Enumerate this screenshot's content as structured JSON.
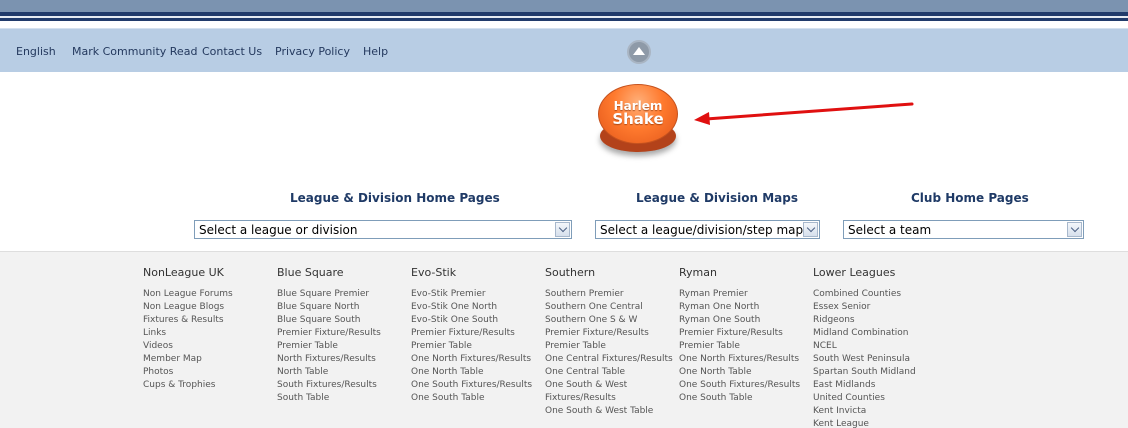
{
  "nav": {
    "links": [
      "English",
      "Mark Community Read",
      "Contact Us",
      "Privacy Policy",
      "Help"
    ]
  },
  "promo": {
    "line1": "Harlem",
    "line2": "Shake"
  },
  "selectors": [
    {
      "title": "League & Division Home Pages",
      "value": "Select a league or division"
    },
    {
      "title": "League & Division Maps",
      "value": "Select a league/division/step map"
    },
    {
      "title": "Club Home Pages",
      "value": "Select a team"
    }
  ],
  "footer": {
    "columns": [
      {
        "heading": "NonLeague UK",
        "items": [
          "Non League Forums",
          "Non League Blogs",
          "Fixtures & Results",
          "Links",
          "Videos",
          "Member Map",
          "Photos",
          "Cups & Trophies"
        ]
      },
      {
        "heading": "Blue Square",
        "items": [
          "Blue Square Premier",
          "Blue Square North",
          "Blue Square South",
          "Premier Fixture/Results",
          "Premier Table",
          "North Fixtures/Results",
          "North Table",
          "South Fixtures/Results",
          "South Table"
        ]
      },
      {
        "heading": "Evo-Stik",
        "items": [
          "Evo-Stik Premier",
          "Evo-Stik One North",
          "Evo-Stik One South",
          "Premier Fixture/Results",
          "Premier Table",
          "One North Fixtures/Results",
          "One North Table",
          "One South Fixtures/Results",
          "One South Table"
        ]
      },
      {
        "heading": "Southern",
        "items": [
          "Southern Premier",
          "Southern One Central",
          "Southern One S & W",
          "Premier Fixture/Results",
          "Premier Table",
          "One Central Fixtures/Results",
          "One Central Table",
          "One South & West",
          "Fixtures/Results",
          "One South & West Table"
        ]
      },
      {
        "heading": "Ryman",
        "items": [
          "Ryman Premier",
          "Ryman One North",
          "Ryman One South",
          "Premier Fixture/Results",
          "Premier Table",
          "One North Fixtures/Results",
          "One North Table",
          "One South Fixtures/Results",
          "One South Table"
        ]
      },
      {
        "heading": "Lower Leagues",
        "items": [
          "Combined Counties",
          "Essex Senior",
          "Ridgeons",
          "Midland Combination",
          "NCEL",
          "South West Peninsula",
          "Spartan South Midland",
          "East Midlands",
          "United Counties",
          "Kent Invicta",
          "Kent League"
        ]
      }
    ]
  },
  "colors": {
    "nav_bg": "#b8cde4",
    "header_dark": "#213b6b",
    "title_blue": "#1f3a66",
    "promo_orange": "#ff7a2e",
    "arrow_red": "#e01010",
    "footer_bg": "#f2f2f2"
  }
}
